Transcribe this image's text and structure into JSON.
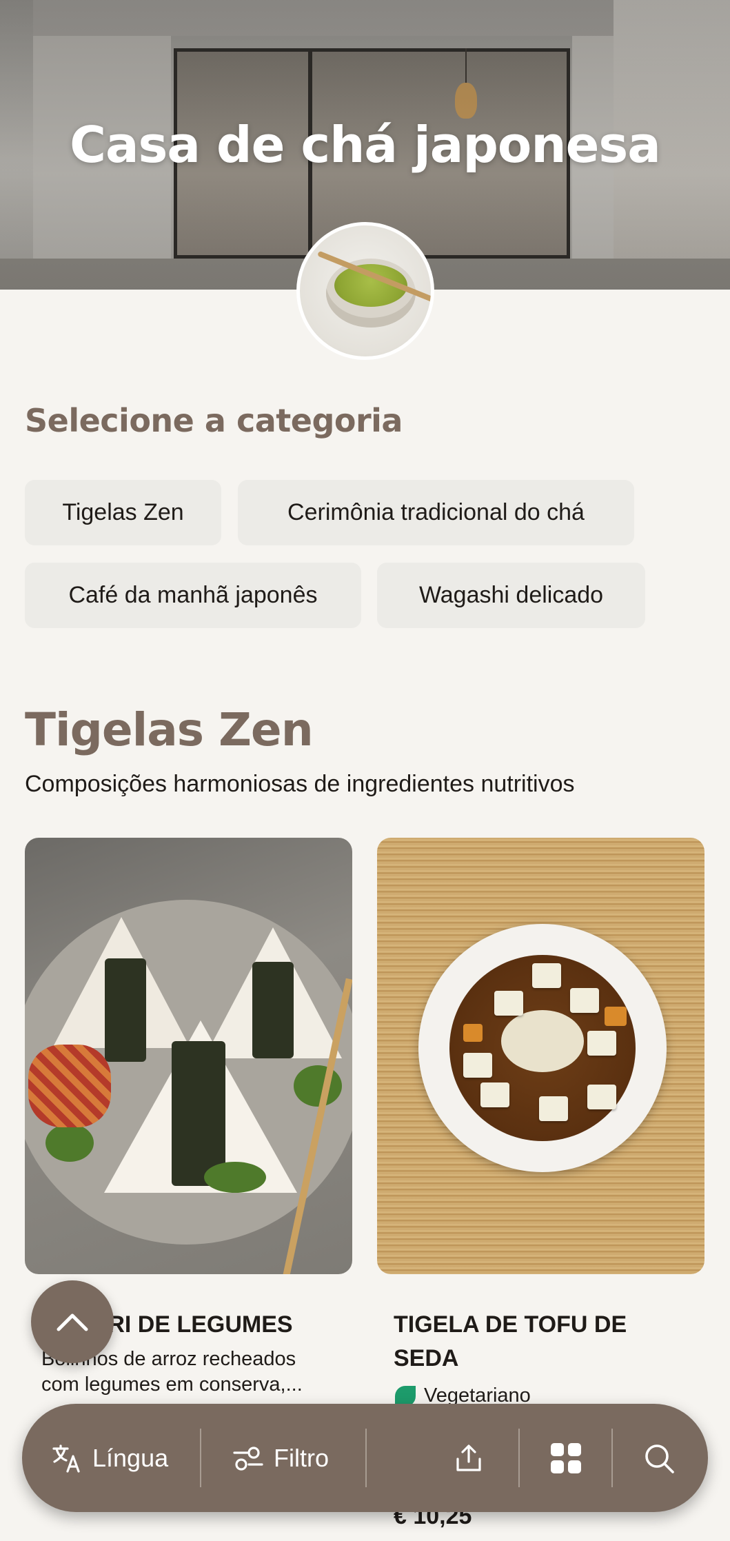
{
  "hero": {
    "title": "Casa de chá japonesa"
  },
  "category": {
    "heading": "Selecione a categoria",
    "chips": [
      "Tigelas Zen",
      "Cerimônia tradicional do chá",
      "Café da manhã japonês",
      "Wagashi delicado"
    ]
  },
  "section": {
    "title": "Tigelas Zen",
    "subtitle": "Composições harmoniosas de ingredientes nutritivos"
  },
  "items": [
    {
      "title": "ONIGIRI DE LEGUMES",
      "visible_title": "RI DE LEGUMES",
      "description_line1": "Bolinhos de arroz recheados",
      "description_line2": "com legumes em conserva,..."
    },
    {
      "title_line1": "TIGELA DE TOFU DE",
      "title_line2": "SEDA",
      "tag": "Vegetariano",
      "price": "€ 10,25"
    }
  ],
  "toolbar": {
    "language": "Língua",
    "filter": "Filtro"
  },
  "icons": {
    "scroll_top": "chevron-up-icon",
    "language": "translate-icon",
    "filter": "sliders-icon",
    "share": "share-icon",
    "grid": "grid-icon",
    "search": "search-icon",
    "vegetarian": "leaf-icon"
  },
  "colors": {
    "accent": "#7a6a5f",
    "heading": "#7b6a5f",
    "background": "#f6f4f0",
    "chip": "#ecebe7",
    "vegetarian": "#1d9b6b"
  }
}
